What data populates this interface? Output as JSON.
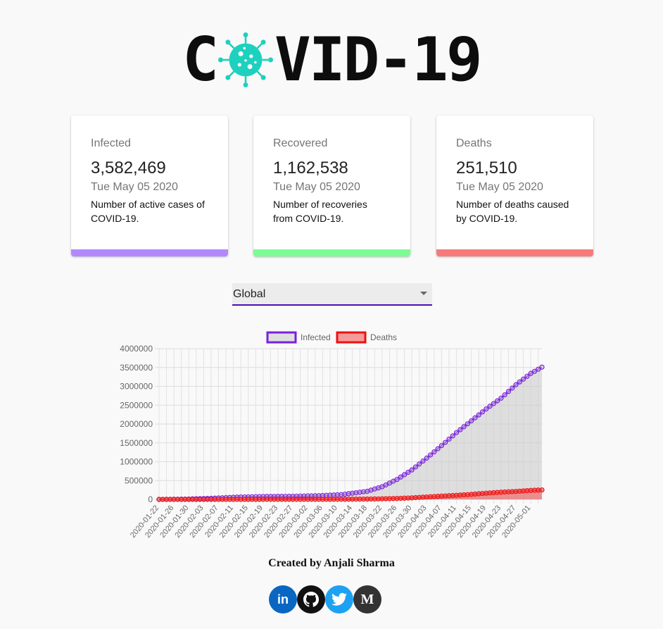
{
  "header": {
    "title_left": "C",
    "title_right": "VID-19",
    "logo_icon": "virus-icon",
    "logo_color": "#1dd1be"
  },
  "cards": [
    {
      "label": "Infected",
      "value": "3,582,469",
      "date": "Tue May 05 2020",
      "description": "Number of active cases of COVID-19.",
      "color": "#b388ff"
    },
    {
      "label": "Recovered",
      "value": "1,162,538",
      "date": "Tue May 05 2020",
      "description": "Number of recoveries from COVID-19.",
      "color": "#7cfc94"
    },
    {
      "label": "Deaths",
      "value": "251,510",
      "date": "Tue May 05 2020",
      "description": "Number of deaths caused by COVID-19.",
      "color": "#f77a7a"
    }
  ],
  "country_select": {
    "value": "Global"
  },
  "chart_data": {
    "type": "line",
    "legend_placement": "top",
    "grid": true,
    "ylim": [
      0,
      4000000
    ],
    "y_ticks": [
      "4000000",
      "3500000",
      "3000000",
      "2500000",
      "2000000",
      "1500000",
      "1000000",
      "500000",
      "0"
    ],
    "x_tick_labels": [
      "2020-01-22",
      "2020-01-26",
      "2020-01-30",
      "2020-02-03",
      "2020-02-07",
      "2020-02-11",
      "2020-02-15",
      "2020-02-19",
      "2020-02-23",
      "2020-02-27",
      "2020-03-02",
      "2020-03-06",
      "2020-03-10",
      "2020-03-14",
      "2020-03-18",
      "2020-03-22",
      "2020-03-26",
      "2020-03-30",
      "2020-04-03",
      "2020-04-07",
      "2020-04-11",
      "2020-04-15",
      "2020-04-19",
      "2020-04-23",
      "2020-04-27",
      "2020-05-01"
    ],
    "x_start": "2020-01-22",
    "x_end": "2020-05-04",
    "series": [
      {
        "name": "Infected",
        "color": "#7a1fe0",
        "fill": "rgba(200,200,200,0.55)",
        "key_points": [
          [
            "2020-01-22",
            600
          ],
          [
            "2020-01-29",
            7800
          ],
          [
            "2020-02-05",
            28200
          ],
          [
            "2020-02-12",
            60300
          ],
          [
            "2020-02-19",
            75700
          ],
          [
            "2020-02-26",
            81400
          ],
          [
            "2020-03-04",
            95100
          ],
          [
            "2020-03-11",
            126100
          ],
          [
            "2020-03-18",
            214900
          ],
          [
            "2020-03-22",
            336000
          ],
          [
            "2020-03-26",
            529600
          ],
          [
            "2020-03-30",
            782300
          ],
          [
            "2020-04-03",
            1095900
          ],
          [
            "2020-04-07",
            1426000
          ],
          [
            "2020-04-11",
            1772000
          ],
          [
            "2020-04-15",
            2084000
          ],
          [
            "2020-04-19",
            2401000
          ],
          [
            "2020-04-23",
            2686000
          ],
          [
            "2020-04-27",
            3042000
          ],
          [
            "2020-05-01",
            3343000
          ],
          [
            "2020-05-04",
            3510000
          ]
        ]
      },
      {
        "name": "Deaths",
        "color": "#ee1111",
        "fill": "rgba(240,90,90,0.6)",
        "key_points": [
          [
            "2020-01-22",
            17
          ],
          [
            "2020-02-05",
            565
          ],
          [
            "2020-02-19",
            2122
          ],
          [
            "2020-03-04",
            3286
          ],
          [
            "2020-03-11",
            4615
          ],
          [
            "2020-03-18",
            8733
          ],
          [
            "2020-03-22",
            14634
          ],
          [
            "2020-03-26",
            23970
          ],
          [
            "2020-03-30",
            40598
          ],
          [
            "2020-04-03",
            64606
          ],
          [
            "2020-04-07",
            86700
          ],
          [
            "2020-04-11",
            108500
          ],
          [
            "2020-04-15",
            134100
          ],
          [
            "2020-04-19",
            165000
          ],
          [
            "2020-04-23",
            190900
          ],
          [
            "2020-04-27",
            211200
          ],
          [
            "2020-05-01",
            238600
          ],
          [
            "2020-05-04",
            251510
          ]
        ]
      }
    ]
  },
  "footer": {
    "credit": "Created by Anjali Sharma",
    "socials": [
      {
        "icon": "linkedin-icon",
        "glyph": "in",
        "color": "#0a66c2"
      },
      {
        "icon": "github-icon",
        "glyph": "",
        "color": "#111111"
      },
      {
        "icon": "twitter-icon",
        "glyph": "",
        "color": "#1da1f2"
      },
      {
        "icon": "medium-icon",
        "glyph": "M",
        "color": "#333333"
      }
    ]
  }
}
